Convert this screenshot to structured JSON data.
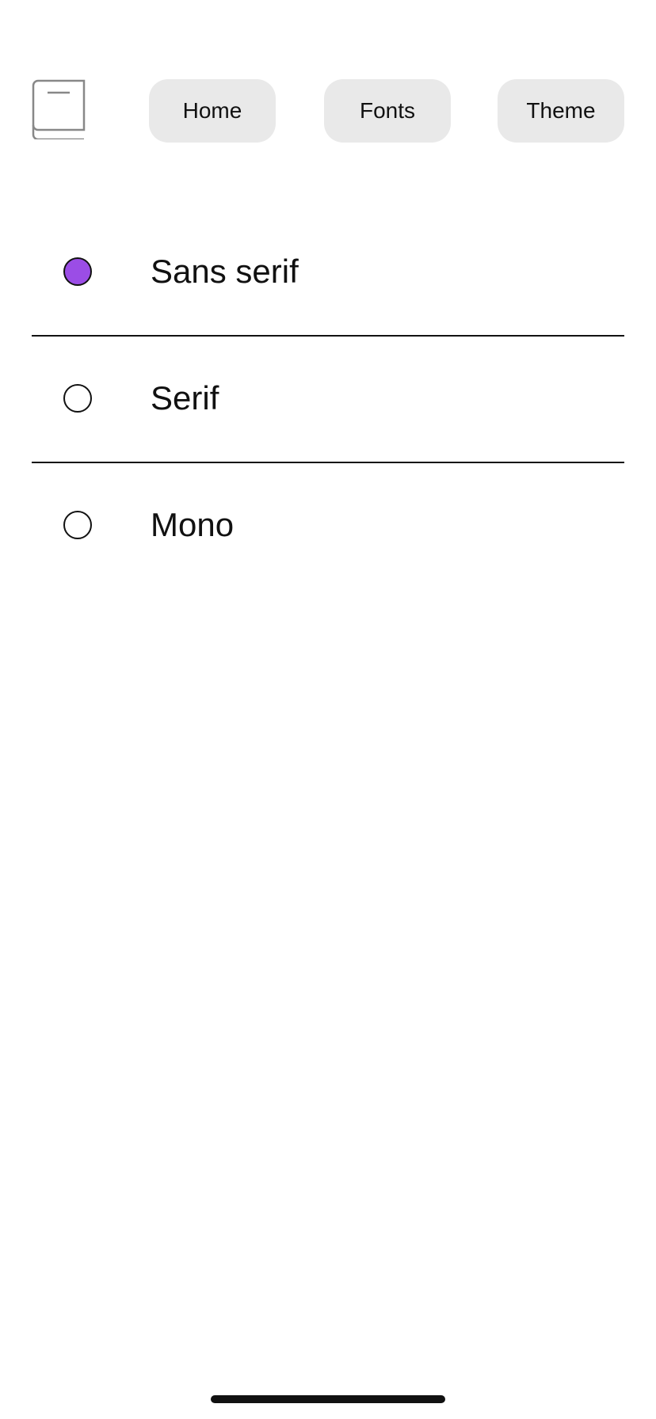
{
  "nav": {
    "logo_icon": "book-icon",
    "items": [
      {
        "label": "Home"
      },
      {
        "label": "Fonts"
      },
      {
        "label": "Theme"
      }
    ]
  },
  "fonts": {
    "options": [
      {
        "label": "Sans serif",
        "selected": true
      },
      {
        "label": "Serif",
        "selected": false
      },
      {
        "label": "Mono",
        "selected": false
      }
    ],
    "accent_color": "#9b4de6"
  }
}
